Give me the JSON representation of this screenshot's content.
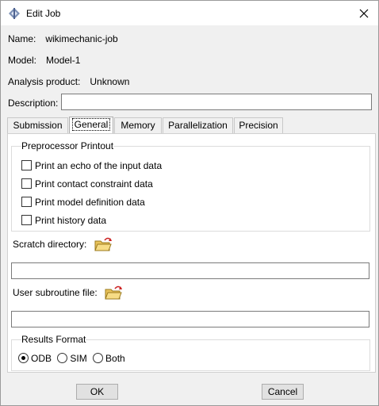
{
  "window": {
    "title": "Edit Job"
  },
  "fields": {
    "name_label": "Name:",
    "name_value": "wikimechanic-job",
    "model_label": "Model:",
    "model_value": "Model-1",
    "product_label": "Analysis product:",
    "product_value": "Unknown",
    "description_label": "Description:",
    "description_value": ""
  },
  "tabs": [
    {
      "label": "Submission"
    },
    {
      "label": "General",
      "active": true
    },
    {
      "label": "Memory"
    },
    {
      "label": "Parallelization"
    },
    {
      "label": "Precision"
    }
  ],
  "general": {
    "preprocessor_title": "Preprocessor Printout",
    "options": [
      {
        "label": "Print an echo of the input data",
        "checked": false
      },
      {
        "label": "Print contact constraint data",
        "checked": false
      },
      {
        "label": "Print model definition data",
        "checked": false
      },
      {
        "label": "Print history data",
        "checked": false
      }
    ],
    "scratch_label": "Scratch directory:",
    "scratch_value": "",
    "subroutine_label": "User subroutine file:",
    "subroutine_value": "",
    "results_title": "Results Format",
    "results_options": [
      {
        "label": "ODB",
        "selected": true
      },
      {
        "label": "SIM",
        "selected": false
      },
      {
        "label": "Both",
        "selected": false
      }
    ]
  },
  "buttons": {
    "ok": "OK",
    "cancel": "Cancel"
  },
  "icons": {
    "app": "abaqus-app-icon",
    "close": "close-icon",
    "folder": "folder-open-icon"
  }
}
